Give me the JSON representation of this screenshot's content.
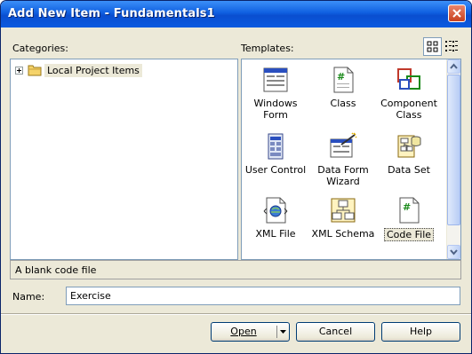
{
  "window": {
    "title": "Add New Item - Fundamentals1"
  },
  "labels": {
    "categories": "Categories:",
    "templates": "Templates:",
    "name": "Name:"
  },
  "categories": {
    "items": [
      {
        "label": "Local Project Items",
        "expanded": false
      }
    ]
  },
  "templates": {
    "items": [
      {
        "label": "Windows Form",
        "icon": "windows-form-icon"
      },
      {
        "label": "Class",
        "icon": "class-file-icon"
      },
      {
        "label": "Component Class",
        "icon": "component-class-icon"
      },
      {
        "label": "User Control",
        "icon": "user-control-icon"
      },
      {
        "label": "Data Form Wizard",
        "icon": "data-form-wizard-icon"
      },
      {
        "label": "Data Set",
        "icon": "data-set-icon"
      },
      {
        "label": "XML File",
        "icon": "xml-file-icon"
      },
      {
        "label": "XML Schema",
        "icon": "xml-schema-icon"
      },
      {
        "label": "Code File",
        "icon": "code-file-icon",
        "selected": true
      }
    ]
  },
  "view_toggle": {
    "large_icons": "large-icons-view-icon",
    "small_icons": "small-icons-view-icon",
    "active": "large"
  },
  "description": "A blank code file",
  "name_field": {
    "value": "Exercise"
  },
  "buttons": {
    "open": "Open",
    "cancel": "Cancel",
    "help": "Help"
  },
  "colors": {
    "titlebar": "#0a4ed0",
    "face": "#ece9d8",
    "border": "#7f9db9"
  }
}
